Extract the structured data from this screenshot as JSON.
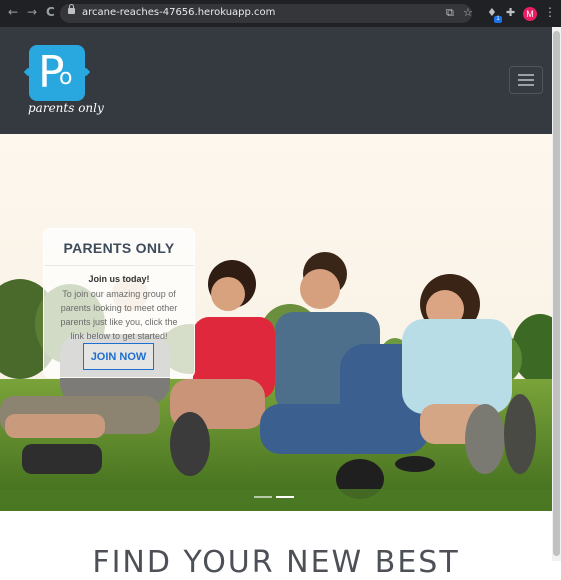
{
  "browser": {
    "url": "arcane-reaches-47656.herokuapp.com",
    "back_icon": "←",
    "forward_icon": "→",
    "reload_icon": "C",
    "ext_badge": "1",
    "profile_initial": "M",
    "menu_icon": "⋮"
  },
  "navbar": {
    "logo_letter_p": "P",
    "logo_letter_o": "o",
    "tagline": "parents only",
    "colors": {
      "background": "#343a40",
      "logo": "#29a8e0"
    }
  },
  "hero": {
    "card": {
      "title": "PARENTS ONLY",
      "lead": "Join us today!",
      "body": "To join our amazing group of parents looking to meet other parents just like you, click the link below to get started!",
      "button": "JOIN NOW"
    },
    "carousel": {
      "slides": 3,
      "active_slide": 2
    }
  },
  "section": {
    "heading": "FIND YOUR NEW BEST"
  }
}
